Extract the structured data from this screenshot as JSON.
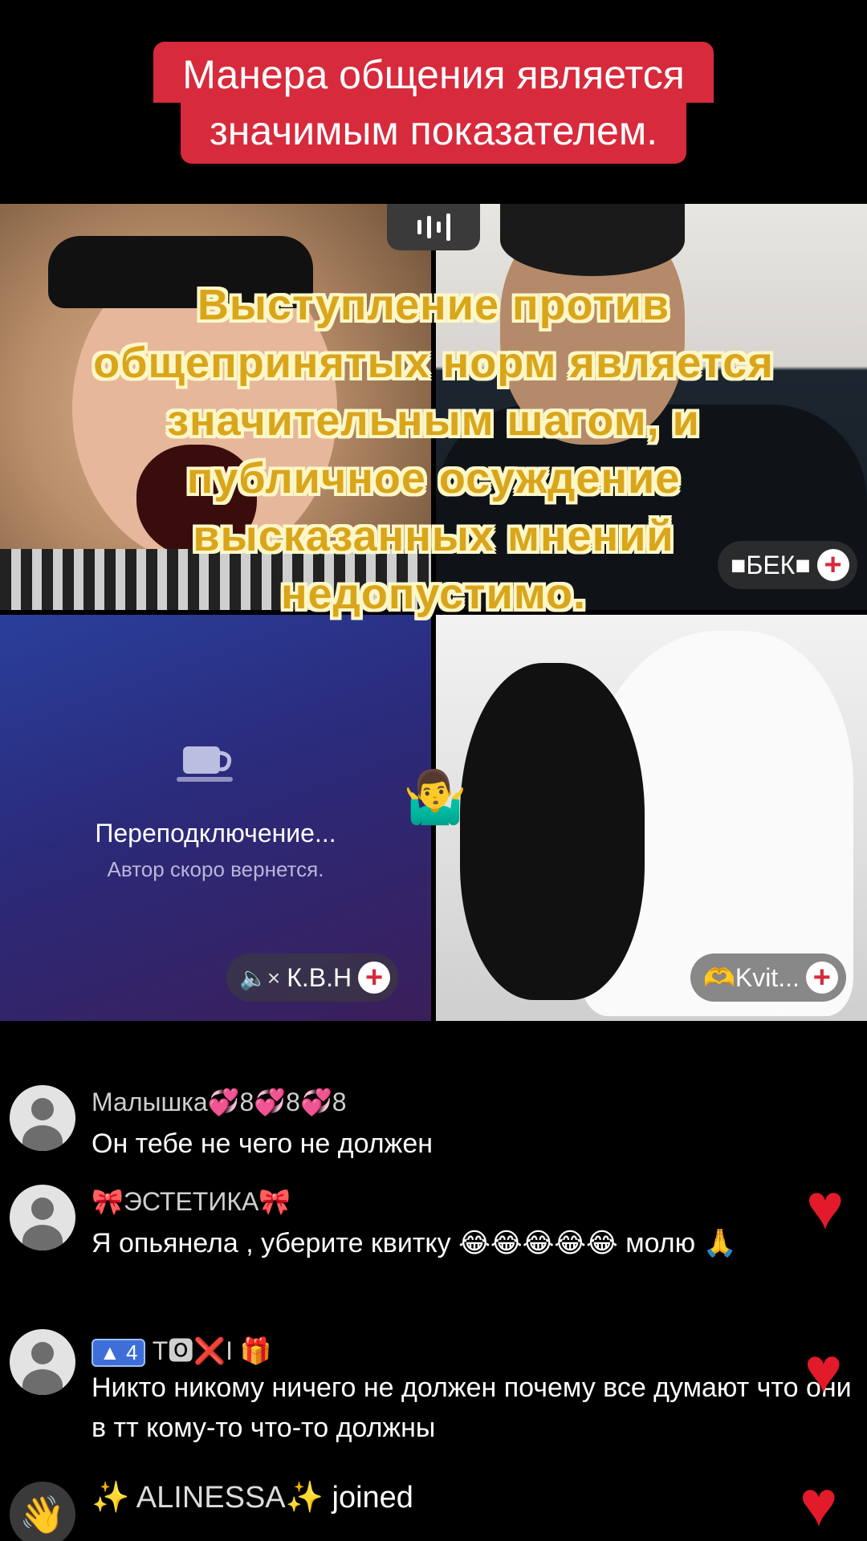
{
  "top_caption": {
    "line1": "Манера общения является",
    "line2": "значимым показателем."
  },
  "overlay_caption": {
    "lines": [
      "Выступление против",
      "общепринятых норм является",
      "значительным шагом, и",
      "публичное осуждение",
      "высказанных мнений",
      "недопустимо."
    ],
    "emoji": "🤷‍♂️"
  },
  "participants": {
    "bek": {
      "label": "■БЕК■"
    },
    "kvn": {
      "label": "К.В.Н",
      "muted_icon": "speaker-muted-icon"
    },
    "kvit": {
      "label": "🫶Kvit..."
    }
  },
  "reconnect": {
    "title": "Переподключение...",
    "subtitle": "Автор скоро вернется."
  },
  "comments": [
    {
      "name": "Малышка💞8💞8💞8",
      "text": "Он тебе не чего не должен"
    },
    {
      "name": "🎀ЭСТЕТИКА🎀",
      "text": "Я опьянела , уберите квитку 😂😂😂😂😂 молю 🙏"
    },
    {
      "name_badge": "4",
      "name_suffix": "T🅾❌I 🎁",
      "text": "Никто никому ничего не должен почему все думают что они в тт кому-то что-то должны"
    }
  ],
  "joined": {
    "name": "✨ ALINESSA✨",
    "action": "joined"
  },
  "colors": {
    "caption_red": "#d72a3c",
    "overlay_yellow": "#d9a51b",
    "heart": "#e21a2a"
  }
}
